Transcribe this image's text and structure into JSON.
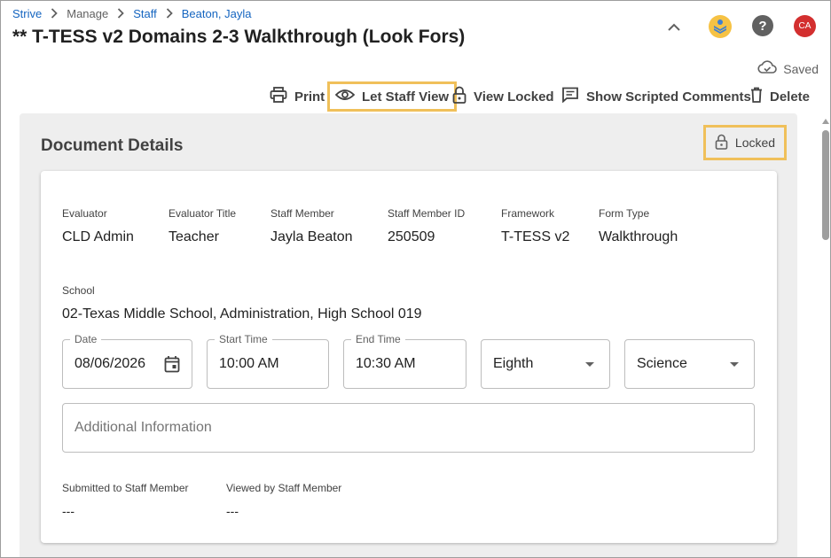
{
  "breadcrumb": [
    {
      "label": "Strive",
      "link": true
    },
    {
      "label": "Manage",
      "link": false
    },
    {
      "label": "Staff",
      "link": true
    },
    {
      "label": "Beaton, Jayla",
      "link": true
    }
  ],
  "page_title": "** T-TESS v2 Domains 2-3 Walkthrough (Look Fors)",
  "header": {
    "avatar_initials": "CA",
    "help_glyph": "?",
    "icons": [
      "chevron-up-icon",
      "app-logo-icon",
      "help-icon",
      "avatar"
    ]
  },
  "status": {
    "saved_label": "Saved"
  },
  "toolbar": {
    "print": "Print",
    "let_staff_view": "Let Staff View",
    "view_locked": "View Locked",
    "show_scripted_comments": "Show Scripted Comments",
    "delete": "Delete"
  },
  "document_details": {
    "section_title": "Document Details",
    "locked_label": "Locked",
    "fields": [
      {
        "label": "Evaluator",
        "value": "CLD Admin"
      },
      {
        "label": "Evaluator Title",
        "value": "Teacher"
      },
      {
        "label": "Staff Member",
        "value": "Jayla Beaton"
      },
      {
        "label": "Staff Member ID",
        "value": "250509"
      },
      {
        "label": "Framework",
        "value": "T-TESS v2"
      },
      {
        "label": "Form Type",
        "value": "Walkthrough"
      }
    ],
    "school": {
      "label": "School",
      "value": "02-Texas Middle School, Administration, High School 019"
    },
    "date": {
      "label": "Date",
      "value": "08/06/2026"
    },
    "start_time": {
      "label": "Start Time",
      "value": "10:00 AM"
    },
    "end_time": {
      "label": "End Time",
      "value": "10:30 AM"
    },
    "grade": {
      "value": "Eighth"
    },
    "subject": {
      "value": "Science"
    },
    "additional_info": {
      "placeholder": "Additional Information",
      "value": ""
    },
    "submitted": {
      "label": "Submitted to Staff Member",
      "value": "---"
    },
    "viewed": {
      "label": "Viewed by Staff Member",
      "value": "---"
    }
  },
  "colors": {
    "link": "#1565c0",
    "highlight": "#f0c05a",
    "avatar": "#d32f2f",
    "logo": "#f6c244",
    "panel_bg": "#eeeeee"
  }
}
